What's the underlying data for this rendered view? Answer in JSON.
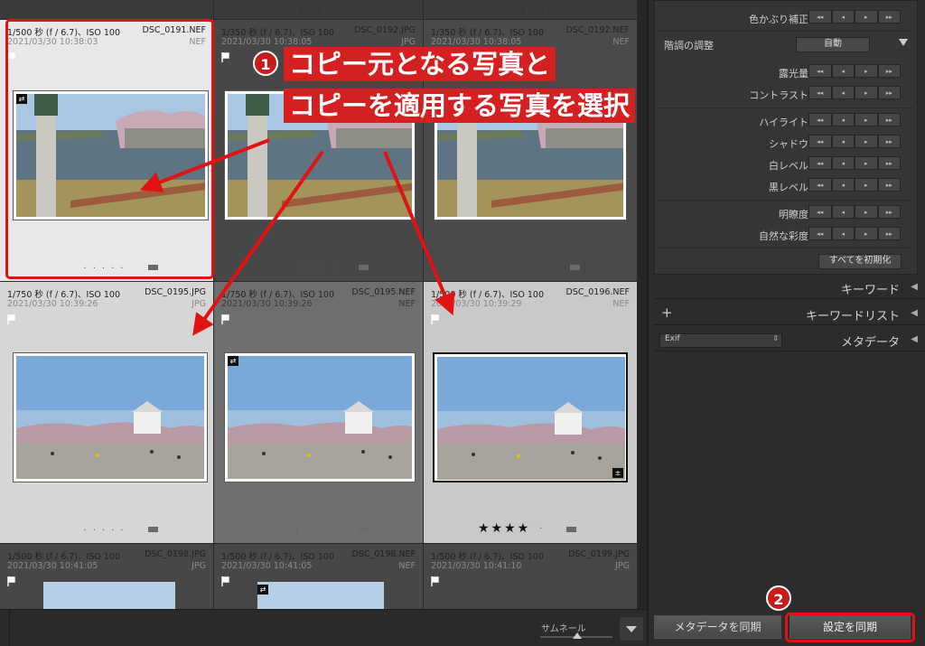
{
  "grid": {
    "cells": [
      {
        "line1": "1/500 秒 (f / 6.7)、ISO 100",
        "file": "DSC_0191.NEF",
        "date": "2021/03/30 10:38:03",
        "ext": "NEF",
        "photo": "castle-moat"
      },
      {
        "line1": "1/350 秒 (f / 6.7)、ISO 100",
        "file": "DSC_0192.JPG",
        "date": "2021/03/30 10:38:05",
        "ext": "JPG",
        "photo": "castle-moat"
      },
      {
        "line1": "1/350 秒 (f / 6.7)、ISO 100",
        "file": "DSC_0192.NEF",
        "date": "2021/03/30 10:38:05",
        "ext": "NEF",
        "photo": "castle-moat"
      },
      {
        "line1": "1/750 秒 (f / 6.7)、ISO 100",
        "file": "DSC_0195.JPG",
        "date": "2021/03/30 10:39:26",
        "ext": "JPG",
        "photo": "castle-park"
      },
      {
        "line1": "1/750 秒 (f / 6.7)、ISO 100",
        "file": "DSC_0195.NEF",
        "date": "2021/03/30 10:39:26",
        "ext": "NEF",
        "photo": "castle-park"
      },
      {
        "line1": "1/500 秒 (f / 6.7)、ISO 100",
        "file": "DSC_0196.NEF",
        "date": "2021/03/30 10:39:29",
        "ext": "NEF",
        "photo": "castle-park"
      },
      {
        "line1": "1/500 秒 (f / 6.7)、ISO 100",
        "file": "DSC_0198.JPG",
        "date": "2021/03/30 10:41:05",
        "ext": "JPG",
        "photo": "sky"
      },
      {
        "line1": "1/500 秒 (f / 6.7)、ISO 100",
        "file": "DSC_0198.NEF",
        "date": "2021/03/30 10:41:05",
        "ext": "NEF",
        "photo": "sky"
      },
      {
        "line1": "1/500 秒 (f / 6.7)、ISO 100",
        "file": "DSC_0199.JPG",
        "date": "2021/03/30 10:41:10",
        "ext": "JPG",
        "photo": "none"
      }
    ],
    "rating_stars": "★★★★",
    "rating_value": 4
  },
  "panel": {
    "rows_top": [
      {
        "label": "色かぶり補正"
      }
    ],
    "tone_section": {
      "title": "階調の調整",
      "dropdown": "自動"
    },
    "rows_tone": [
      {
        "label": "露光量"
      },
      {
        "label": "コントラスト"
      }
    ],
    "rows_light": [
      {
        "label": "ハイライト"
      },
      {
        "label": "シャドウ"
      },
      {
        "label": "白レベル"
      },
      {
        "label": "黒レベル"
      }
    ],
    "rows_presence": [
      {
        "label": "明瞭度"
      },
      {
        "label": "自然な彩度"
      }
    ],
    "reset_all": "すべてを初期化",
    "keyword": "キーワード",
    "keyword_list": "キーワードリスト",
    "metadata": "メタデータ",
    "metadata_preset": "Exif",
    "stepper_glyphs": [
      "◂◂",
      "◂",
      "▸",
      "▸▸"
    ]
  },
  "bottom": {
    "thumbnail_label": "サムネール",
    "sync_metadata": "メタデータを同期",
    "sync_settings": "設定を同期"
  },
  "annotations": {
    "step1_num": "1",
    "step1_line1": "コピー元となる写真と",
    "step1_line2": "コピーを適用する写真を選択",
    "step2_num": "2",
    "accent": "#e01212"
  }
}
